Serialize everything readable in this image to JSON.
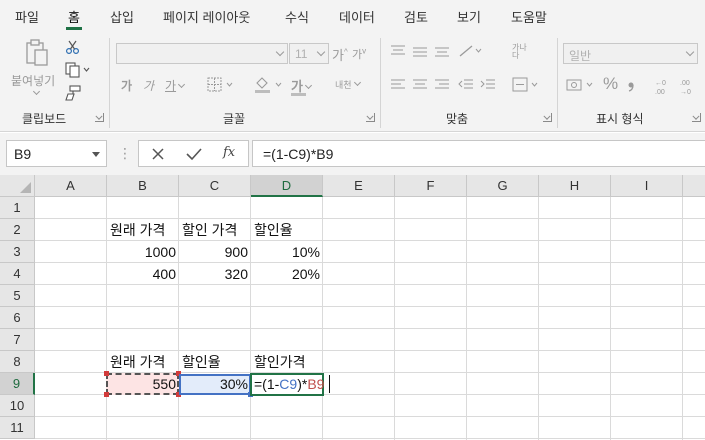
{
  "ribbon_tabs": [
    "파일",
    "홈",
    "삽입",
    "페이지 레이아웃",
    "수식",
    "데이터",
    "검토",
    "보기",
    "도움말"
  ],
  "active_tab": "홈",
  "ribbon": {
    "clipboard": {
      "paste_label": "붙여넣기",
      "group_label": "클립보드"
    },
    "font": {
      "font_size": "11",
      "group_label": "글꼴",
      "grow_label": "가",
      "shrink_label": "가",
      "bold_label": "가",
      "italic_label": "가",
      "underline_label": "가",
      "font_color_label": "가",
      "phonetic_label": "내천"
    },
    "alignment": {
      "group_label": "맞춤",
      "wrap_label": "가나다"
    },
    "number": {
      "format_value": "일반",
      "group_label": "표시 형식",
      "percent_label": "%"
    }
  },
  "formula_bar": {
    "name_box": "B9",
    "formula": "=(1-C9)*B9",
    "fx_label": "fx"
  },
  "columns": [
    "A",
    "B",
    "C",
    "D",
    "E",
    "F",
    "G",
    "H",
    "I"
  ],
  "selected_column": "D",
  "rows": [
    "1",
    "2",
    "3",
    "4",
    "5",
    "6",
    "7",
    "8",
    "9",
    "10",
    "11"
  ],
  "selected_row": "9",
  "cells": {
    "B2": "원래 가격",
    "C2": "할인 가격",
    "D2": "할인율",
    "B3": "1000",
    "C3": "900",
    "D3": "10%",
    "B4": "400",
    "C4": "320",
    "D4": "20%",
    "B8": "원래 가격",
    "C8": "할인율",
    "D8": "할인가격",
    "B9": "550",
    "C9": "30%"
  },
  "editing_cell": {
    "address": "D9",
    "prefix": "=(1-",
    "ref1": "C9",
    "middle": ")*",
    "ref2": "B9"
  },
  "colors": {
    "accent": "#217346",
    "ref_blue": "#4472c4",
    "ref_red": "#c0504d",
    "copy_fill": "#fde4e4",
    "ref_fill": "#e3ecfa"
  }
}
